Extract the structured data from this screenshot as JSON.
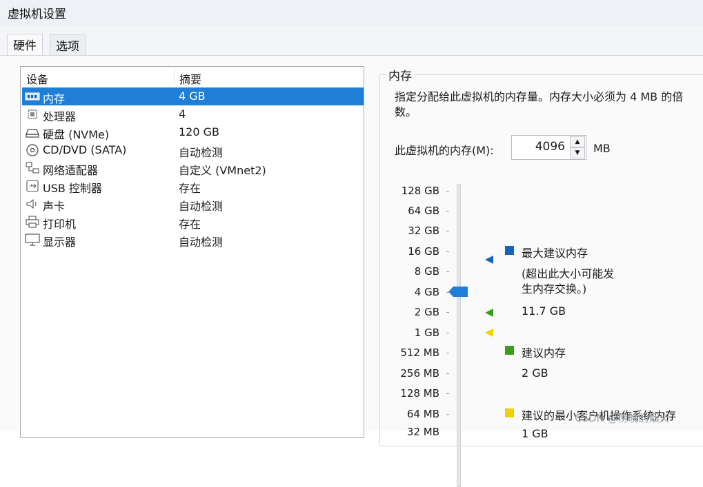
{
  "window": {
    "title": "虚拟机设置"
  },
  "tabs": [
    {
      "label": "硬件"
    },
    {
      "label": "选项"
    }
  ],
  "device_list": {
    "headers": {
      "device": "设备",
      "summary": "摘要"
    },
    "rows": [
      {
        "name": "内存",
        "summary": "4 GB",
        "icon": "memory-icon"
      },
      {
        "name": "处理器",
        "summary": "4",
        "icon": "processor-icon"
      },
      {
        "name": "硬盘 (NVMe)",
        "summary": "120 GB",
        "icon": "hard-disk-icon"
      },
      {
        "name": "CD/DVD (SATA)",
        "summary": "自动检测",
        "icon": "cd-dvd-icon"
      },
      {
        "name": "网络适配器",
        "summary": "自定义 (VMnet2)",
        "icon": "network-adapter-icon"
      },
      {
        "name": "USB 控制器",
        "summary": "存在",
        "icon": "usb-icon"
      },
      {
        "name": "声卡",
        "summary": "自动检测",
        "icon": "speaker-icon"
      },
      {
        "name": "打印机",
        "summary": "存在",
        "icon": "printer-icon"
      },
      {
        "name": "显示器",
        "summary": "自动检测",
        "icon": "monitor-icon"
      }
    ],
    "selected_index": 0
  },
  "memory": {
    "group_label": "内存",
    "description": "指定分配给此虚拟机的内存量。内存大小必须为 4 MB 的倍数。",
    "field_label": "此虚拟机的内存(M):",
    "value": "4096",
    "unit": "MB",
    "scale_ticks": [
      "128 GB",
      "64 GB",
      "32 GB",
      "16 GB",
      "8 GB",
      "4 GB",
      "2 GB",
      "1 GB",
      "512 MB",
      "256 MB",
      "128 MB",
      "64 MB",
      "32 MB"
    ],
    "current": "4 GB",
    "legend": {
      "max": {
        "label": "最大建议内存",
        "note": "(超出此大小可能发生内存交换。)",
        "value": "11.7 GB",
        "color": "#1565b8"
      },
      "recommended": {
        "label": "建议内存",
        "value": "2 GB",
        "color": "#3c9a1c"
      },
      "min_guest": {
        "label": "建议的最小客户机操作系统内存",
        "value": "1 GB",
        "color": "#f2d000"
      }
    }
  },
  "watermark": "CSDN @傍晚的烟火",
  "colors": {
    "selection": "#1f7ed6",
    "thumb": "#1e7fd8"
  }
}
